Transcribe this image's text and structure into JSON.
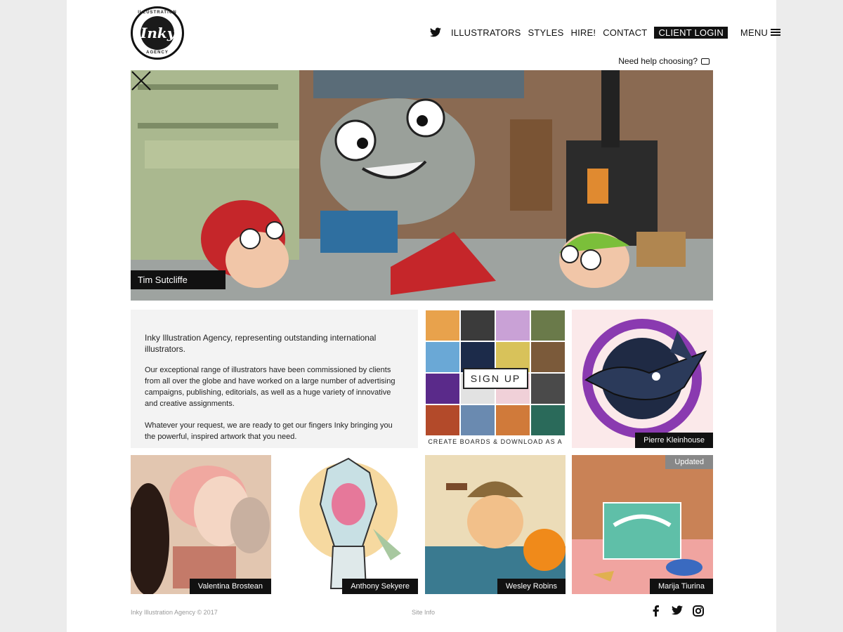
{
  "logo": {
    "top_text": "ILLUSTRATION",
    "main_text": "Inky",
    "bottom_text": "AGENCY"
  },
  "nav": {
    "items": [
      "ILLUSTRATORS",
      "STYLES",
      "HIRE!",
      "CONTACT"
    ],
    "client_login": "CLIENT LOGIN",
    "menu": "MENU"
  },
  "help": {
    "text": "Need help choosing?"
  },
  "hero": {
    "caption": "Tim Sutcliffe"
  },
  "intro": {
    "lead": "Inky Illustration Agency, representing outstanding international illustrators.",
    "p1": "Our exceptional range of illustrators have been commissioned by clients from all over the globe and have worked on a large number of advertising campaigns, publishing, editorials, as well as a huge variety of innovative and creative assignments.",
    "p2": "Whatever your request, we are ready to get our fingers Inky bringing you the powerful, inspired artwork that you need."
  },
  "signup": {
    "button": "SIGN UP",
    "caption": "CREATE BOARDS & DOWNLOAD AS A PDF"
  },
  "tiles": {
    "pierre": "Pierre Kleinhouse",
    "valentina": "Valentina Brostean",
    "anthony": "Anthony Sekyere",
    "wesley": "Wesley Robins",
    "marija": "Marija Tiurina",
    "updated": "Updated"
  },
  "footer": {
    "copyright": "Inky Illustration Agency © 2017",
    "site_info": "Site Info"
  },
  "icons": {
    "social": [
      "facebook-icon",
      "twitter-icon",
      "instagram-icon"
    ]
  }
}
